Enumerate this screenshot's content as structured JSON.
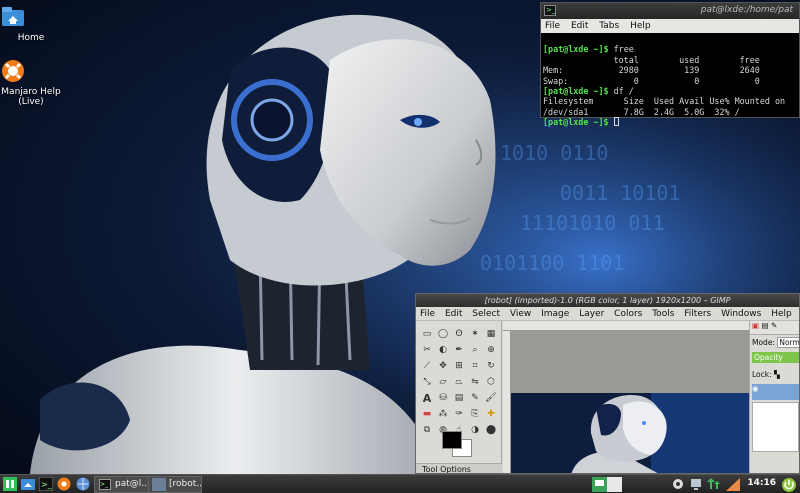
{
  "desktop": {
    "icons": [
      {
        "label": "Home"
      },
      {
        "label": "Manjaro Help (Live)"
      }
    ]
  },
  "terminal": {
    "title": "pat@lxde:/home/pat",
    "menu": [
      "File",
      "Edit",
      "Tabs",
      "Help"
    ],
    "lines": [
      {
        "prompt": "[pat@lxde ~]$",
        "text": " free"
      },
      {
        "prompt": "",
        "text": "              total        used        free"
      },
      {
        "prompt": "",
        "text": "Mem:           2980         139        2640"
      },
      {
        "prompt": "",
        "text": "Swap:             0           0           0"
      },
      {
        "prompt": "[pat@lxde ~]$",
        "text": " df /"
      },
      {
        "prompt": "",
        "text": "Filesystem      Size  Used Avail Use% Mounted on"
      },
      {
        "prompt": "",
        "text": "/dev/sda1       7.8G  2.4G  5.0G  32% /"
      },
      {
        "prompt": "[pat@lxde ~]$",
        "text": " "
      }
    ]
  },
  "gimp": {
    "title": "[robot] (imported)-1.0 (RGB color, 1 layer) 1920x1200 – GIMP",
    "menu": [
      "File",
      "Edit",
      "Select",
      "View",
      "Image",
      "Layer",
      "Colors",
      "Tools",
      "Filters",
      "Windows",
      "Help"
    ],
    "tool_options_label": "Tool Options",
    "layers": {
      "mode_label": "Mode:",
      "mode_value": "Normal",
      "opacity_label": "Opacity",
      "lock_label": "Lock:"
    }
  },
  "taskbar": {
    "tasks": [
      {
        "label": "pat@l..."
      },
      {
        "label": "[robot..."
      }
    ],
    "clock": "14:16"
  }
}
